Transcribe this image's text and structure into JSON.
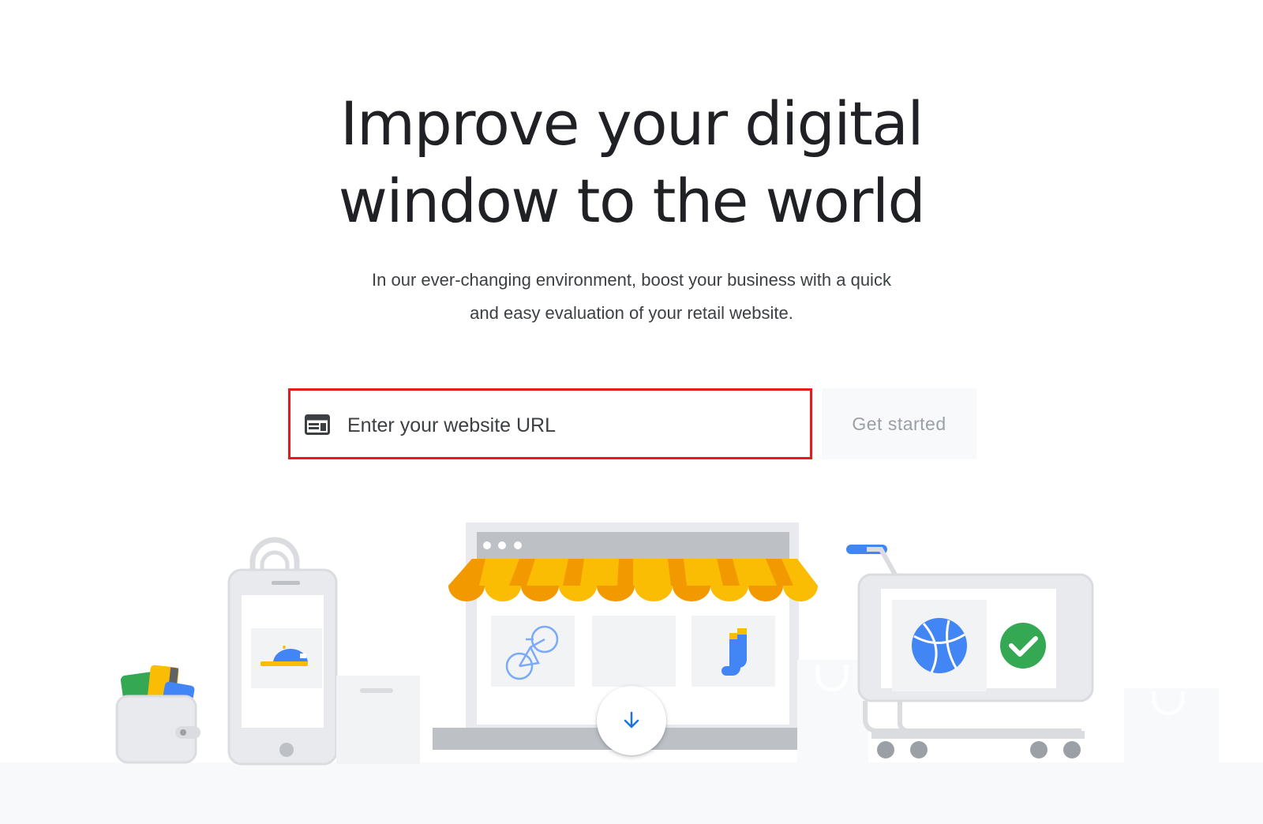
{
  "hero": {
    "headline_line1": "Improve your digital",
    "headline_line2": "window to the world",
    "subtitle_line1": "In our ever-changing environment, boost your business with a quick",
    "subtitle_line2": "and easy evaluation of your retail website."
  },
  "form": {
    "url_placeholder": "Enter your website URL",
    "url_value": "",
    "url_icon": "web-browser-icon",
    "submit_label": "Get started"
  },
  "scroll": {
    "icon": "arrow-down-icon"
  },
  "colors": {
    "text_primary": "#202124",
    "text_secondary": "#3c4043",
    "highlight_border": "#e51c1c",
    "button_bg": "#f8f9fa",
    "button_text": "#9aa0a6",
    "accent_blue": "#1a73e8",
    "awning_orange": "#f29900",
    "awning_yellow": "#fbbc04",
    "check_green": "#34a853"
  }
}
